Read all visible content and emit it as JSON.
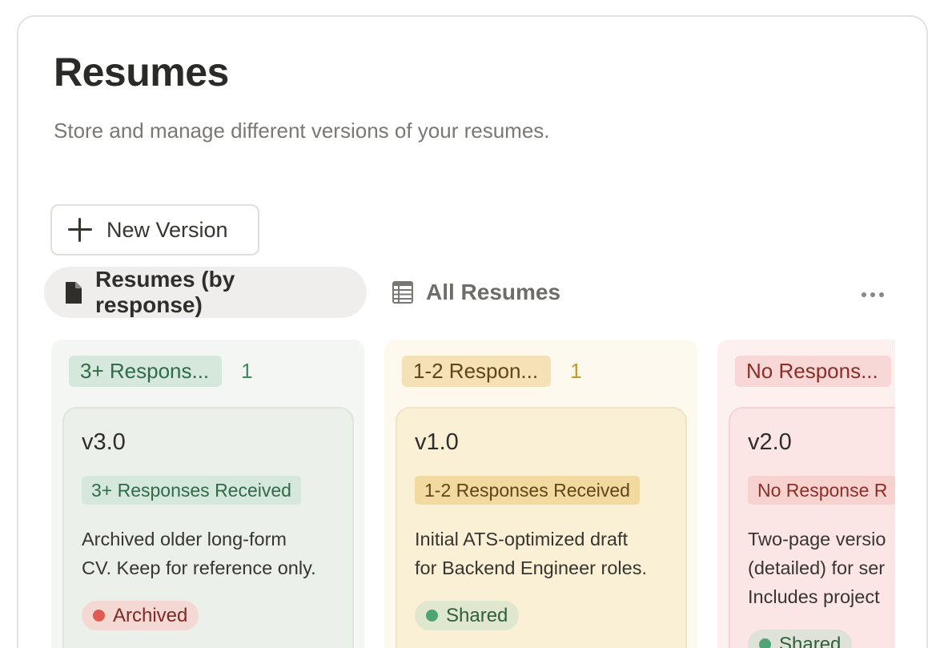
{
  "page": {
    "title": "Resumes",
    "subtitle": "Store and manage different versions of your resumes."
  },
  "toolbar": {
    "new_version_label": "New Version"
  },
  "views": {
    "active": {
      "label": "Resumes (by response)",
      "icon": "document-icon"
    },
    "second": {
      "label": "All Resumes",
      "icon": "table-list-icon"
    }
  },
  "colors": {
    "green_tag_bg": "#d6e7dc",
    "green_tag_text": "#2f6b46",
    "green_count": "#3f8a5c",
    "yellow_tag_bg": "#f4e1b5",
    "yellow_tag_text": "#6b4f1c",
    "yellow_count": "#c59a2c",
    "red_tag_bg": "#f8d8d6",
    "red_tag_text": "#8a2e2a",
    "archived_dot": "#e05a52",
    "shared_dot": "#4fa475"
  },
  "columns": [
    {
      "tag": "3+ Respons...",
      "count": "1",
      "card": {
        "title": "v3.0",
        "status": "3+ Responses Received",
        "description_line1": "Archived older long-form",
        "description_line2": "CV. Keep for reference only.",
        "description_line3": "",
        "badge": "Archived"
      }
    },
    {
      "tag": "1-2 Respon...",
      "count": "1",
      "card": {
        "title": "v1.0",
        "status": "1-2 Responses Received",
        "description_line1": "Initial ATS-optimized draft",
        "description_line2": "for Backend Engineer roles.",
        "description_line3": "",
        "badge": "Shared"
      }
    },
    {
      "tag": "No Respons...",
      "count": "",
      "card": {
        "title": "v2.0",
        "status": "No Response R",
        "description_line1": "Two-page versio",
        "description_line2": "(detailed) for ser",
        "description_line3": "Includes project",
        "badge": "Shared"
      }
    }
  ]
}
